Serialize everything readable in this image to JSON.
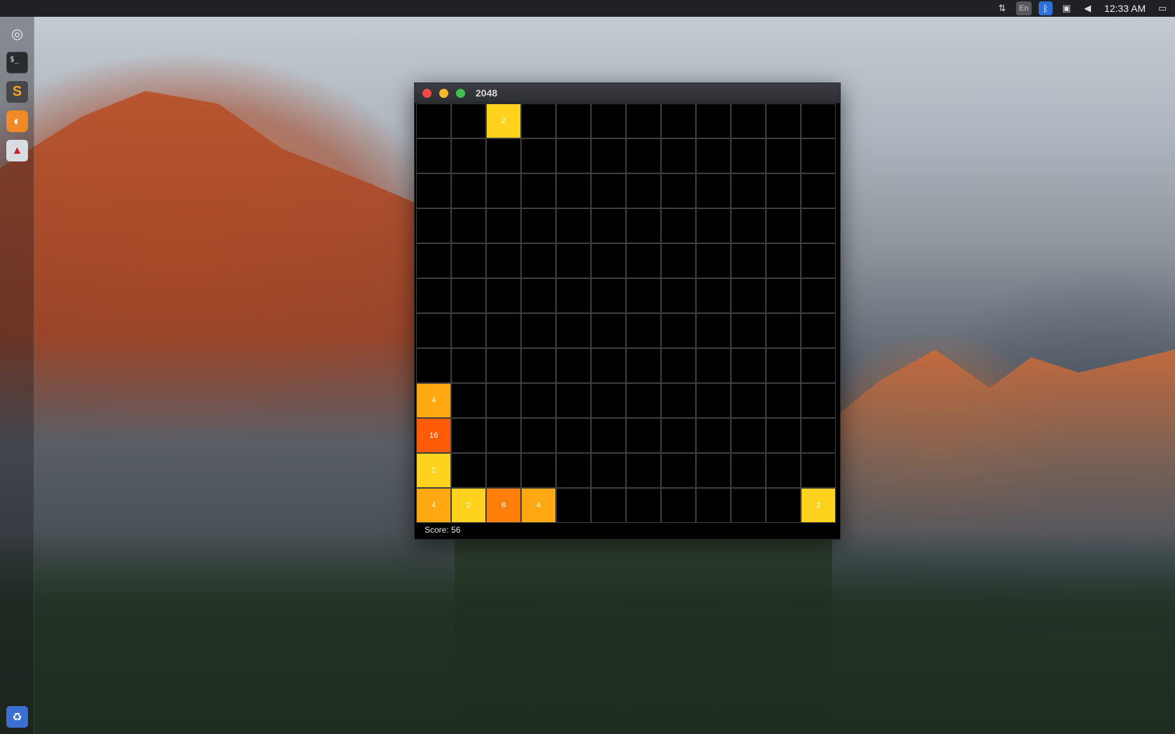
{
  "top_panel": {
    "tray_icons": [
      "network-icon",
      "keyboard-language-icon",
      "bluetooth-icon",
      "clipboard-icon",
      "volume-icon",
      "session-icon"
    ],
    "language": "En",
    "clock": "12:33 AM"
  },
  "launcher": {
    "items": [
      {
        "name": "dash-home",
        "icon": "ubuntu-logo-icon"
      },
      {
        "name": "terminal",
        "icon": "terminal-icon",
        "glyph": "$_"
      },
      {
        "name": "sublime-text",
        "icon": "sublime-icon",
        "glyph": "S"
      },
      {
        "name": "firefox",
        "icon": "firefox-icon"
      },
      {
        "name": "java-app",
        "icon": "java-icon"
      },
      {
        "name": "trash",
        "icon": "trash-icon"
      }
    ]
  },
  "window": {
    "title": "2048",
    "board_size": 12,
    "tiles": [
      {
        "row": 0,
        "col": 2,
        "value": "2"
      },
      {
        "row": 8,
        "col": 0,
        "value": "4"
      },
      {
        "row": 9,
        "col": 0,
        "value": "16"
      },
      {
        "row": 10,
        "col": 0,
        "value": "2"
      },
      {
        "row": 11,
        "col": 0,
        "value": "4"
      },
      {
        "row": 11,
        "col": 1,
        "value": "2"
      },
      {
        "row": 11,
        "col": 2,
        "value": "8"
      },
      {
        "row": 11,
        "col": 3,
        "value": "4"
      },
      {
        "row": 11,
        "col": 11,
        "value": "2"
      }
    ],
    "tile_colors": {
      "2": "#ffd21e",
      "4": "#ffa812",
      "8": "#ff7f0a",
      "16": "#ff5c0a"
    },
    "score_text": "Score: 56"
  }
}
